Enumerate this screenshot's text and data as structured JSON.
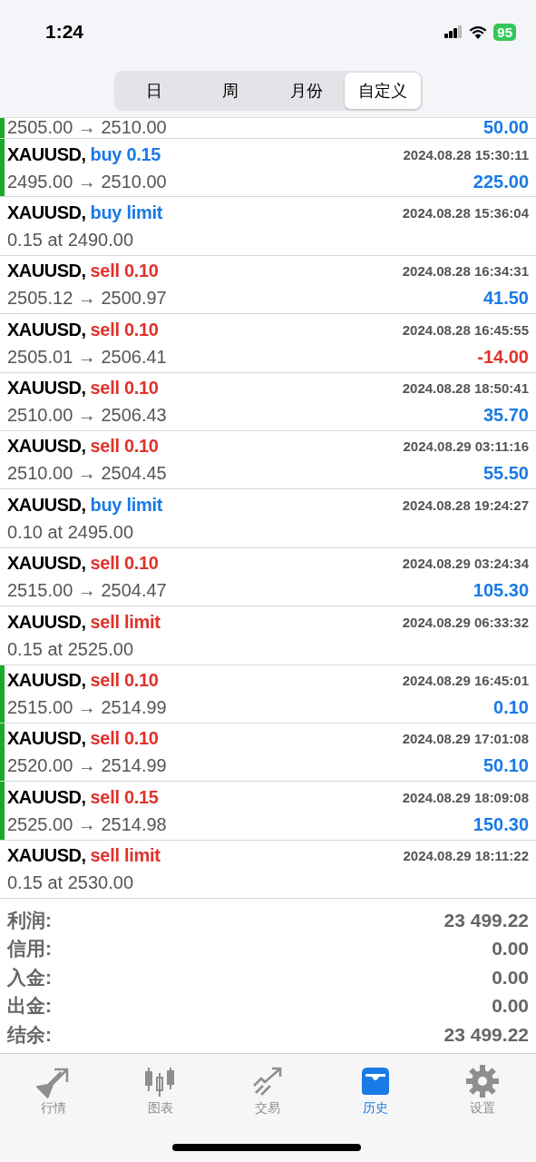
{
  "status_bar": {
    "time": "1:24",
    "battery": "95"
  },
  "tabs": [
    {
      "label": "日",
      "selected": false
    },
    {
      "label": "周",
      "selected": false
    },
    {
      "label": "月份",
      "selected": false
    },
    {
      "label": "自定义",
      "selected": true
    }
  ],
  "rows": [
    {
      "prices": "2505.00 → 2510.00",
      "profit": "50.00",
      "loss": false,
      "marked": true
    },
    {
      "symbol": "XAUUSD,",
      "action": "buy 0.15",
      "kind": "buy",
      "time": "2024.08.28 15:30:11",
      "prices": "2495.00 → 2510.00",
      "profit": "225.00",
      "loss": false,
      "marked": true
    },
    {
      "symbol": "XAUUSD,",
      "action": "buy limit",
      "kind": "buy",
      "time": "2024.08.28 15:36:04",
      "prices": "0.15 at 2490.00",
      "marked": false
    },
    {
      "symbol": "XAUUSD,",
      "action": "sell 0.10",
      "kind": "sell",
      "time": "2024.08.28 16:34:31",
      "prices": "2505.12 → 2500.97",
      "profit": "41.50",
      "loss": false,
      "marked": false
    },
    {
      "symbol": "XAUUSD,",
      "action": "sell 0.10",
      "kind": "sell",
      "time": "2024.08.28 16:45:55",
      "prices": "2505.01 → 2506.41",
      "profit": "-14.00",
      "loss": true,
      "marked": false
    },
    {
      "symbol": "XAUUSD,",
      "action": "sell 0.10",
      "kind": "sell",
      "time": "2024.08.28 18:50:41",
      "prices": "2510.00 → 2506.43",
      "profit": "35.70",
      "loss": false,
      "marked": false
    },
    {
      "symbol": "XAUUSD,",
      "action": "sell 0.10",
      "kind": "sell",
      "time": "2024.08.29 03:11:16",
      "prices": "2510.00 → 2504.45",
      "profit": "55.50",
      "loss": false,
      "marked": false
    },
    {
      "symbol": "XAUUSD,",
      "action": "buy limit",
      "kind": "buy",
      "time": "2024.08.28 19:24:27",
      "prices": "0.10 at 2495.00",
      "marked": false
    },
    {
      "symbol": "XAUUSD,",
      "action": "sell 0.10",
      "kind": "sell",
      "time": "2024.08.29 03:24:34",
      "prices": "2515.00 → 2504.47",
      "profit": "105.30",
      "loss": false,
      "marked": false
    },
    {
      "symbol": "XAUUSD,",
      "action": "sell limit",
      "kind": "sell",
      "time": "2024.08.29 06:33:32",
      "prices": "0.15 at 2525.00",
      "marked": false
    },
    {
      "symbol": "XAUUSD,",
      "action": "sell 0.10",
      "kind": "sell",
      "time": "2024.08.29 16:45:01",
      "prices": "2515.00 → 2514.99",
      "profit": "0.10",
      "loss": false,
      "marked": true
    },
    {
      "symbol": "XAUUSD,",
      "action": "sell 0.10",
      "kind": "sell",
      "time": "2024.08.29 17:01:08",
      "prices": "2520.00 → 2514.99",
      "profit": "50.10",
      "loss": false,
      "marked": true
    },
    {
      "symbol": "XAUUSD,",
      "action": "sell 0.15",
      "kind": "sell",
      "time": "2024.08.29 18:09:08",
      "prices": "2525.00 → 2514.98",
      "profit": "150.30",
      "loss": false,
      "marked": true
    },
    {
      "symbol": "XAUUSD,",
      "action": "sell limit",
      "kind": "sell",
      "time": "2024.08.29 18:11:22",
      "prices": "0.15 at 2530.00",
      "marked": false
    }
  ],
  "summary": [
    {
      "label": "利润:",
      "value": "23 499.22"
    },
    {
      "label": "信用:",
      "value": "0.00"
    },
    {
      "label": "入金:",
      "value": "0.00"
    },
    {
      "label": "出金:",
      "value": "0.00"
    },
    {
      "label": "结余:",
      "value": "23 499.22"
    }
  ],
  "tab_bar": [
    {
      "label": "行情",
      "kind": "quotes",
      "selected": false
    },
    {
      "label": "图表",
      "kind": "chart",
      "selected": false
    },
    {
      "label": "交易",
      "kind": "trade",
      "selected": false
    },
    {
      "label": "历史",
      "kind": "history",
      "selected": true
    },
    {
      "label": "设置",
      "kind": "settings",
      "selected": false
    }
  ]
}
